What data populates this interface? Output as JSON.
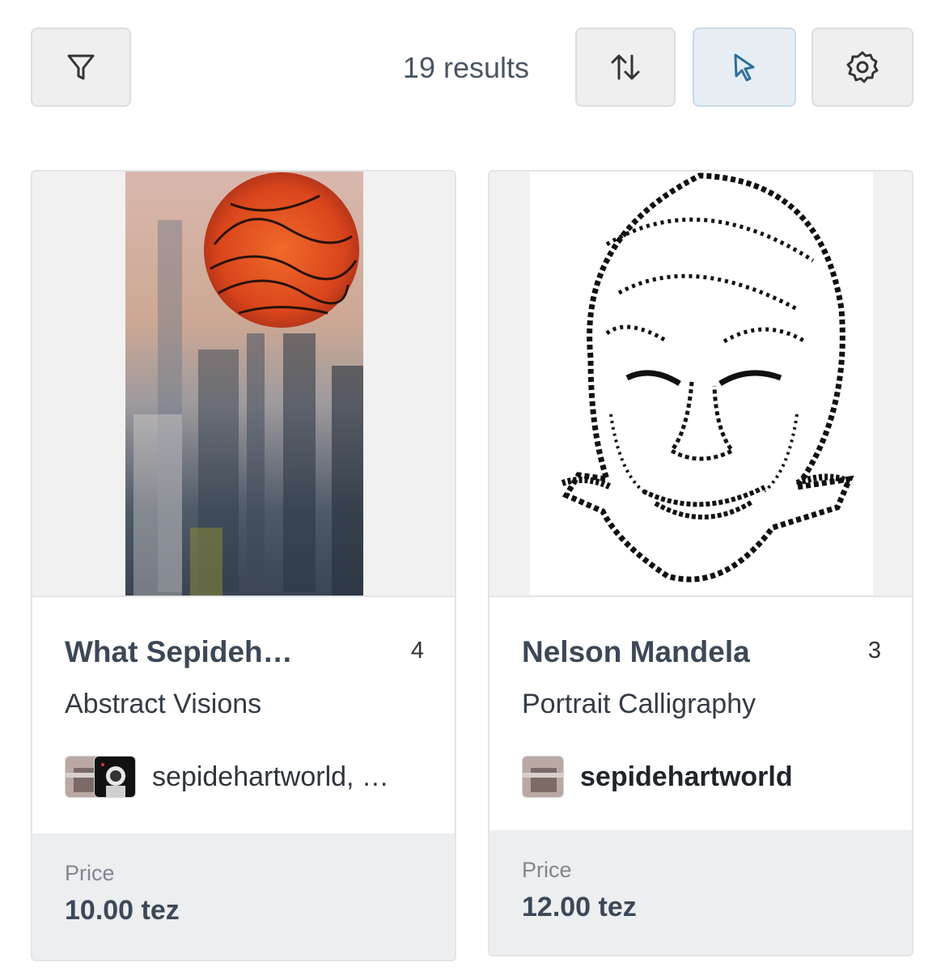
{
  "toolbar": {
    "results_text": "19 results",
    "icons": [
      "filter-icon",
      "sort-icon",
      "cursor-icon",
      "gear-icon"
    ],
    "active_color": "#2f6f9a"
  },
  "cards": [
    {
      "title": "What Sepideh…",
      "edition": "4",
      "collection": "Abstract Visions",
      "creators": "sepidehartworld, …",
      "price_label": "Price",
      "price": "10.00 tez"
    },
    {
      "title": "Nelson Mandela",
      "edition": "3",
      "collection": "Portrait Calligraphy",
      "creators": "sepidehartworld",
      "price_label": "Price",
      "price": "12.00 tez"
    }
  ]
}
